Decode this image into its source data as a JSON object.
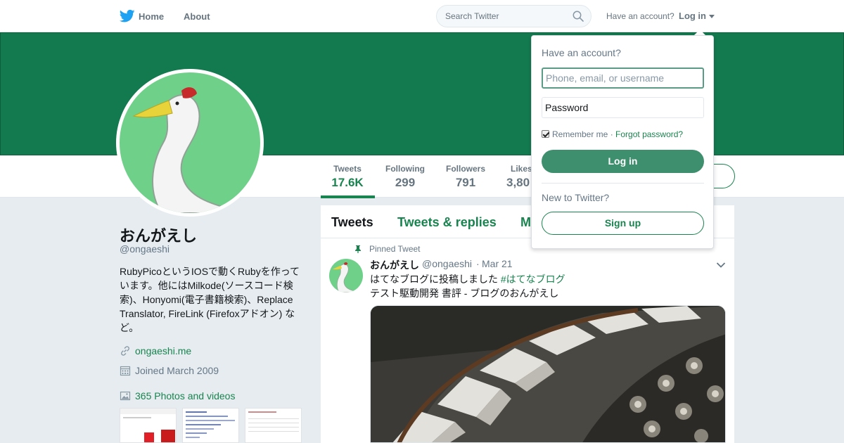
{
  "nav": {
    "logo_icon": "twitter-bird-icon",
    "home_label": "Home",
    "about_label": "About",
    "search_placeholder": "Search Twitter",
    "have_account": "Have an account?",
    "login_label": "Log in"
  },
  "colors": {
    "brand": "#19844f",
    "banner": "#137a4f",
    "background": "#e6ecf0"
  },
  "profile": {
    "name": "おんがえし",
    "handle": "@ongaeshi",
    "bio": "RubyPicoというIOSで動くRubyを作っています。他にはMilkode(ソースコード検索)、Honyomi(電子書籍検索)、Replace Translator, FireLink (Firefoxアドオン) など。",
    "website": "ongaeshi.me",
    "joined": "Joined March 2009",
    "photos_videos": "365 Photos and videos"
  },
  "stats": [
    {
      "label": "Tweets",
      "value": "17.6K"
    },
    {
      "label": "Following",
      "value": "299"
    },
    {
      "label": "Followers",
      "value": "791"
    },
    {
      "label": "Likes",
      "value": "3,80"
    }
  ],
  "tabs": [
    "Tweets",
    "Tweets & replies",
    "M"
  ],
  "tweet": {
    "pinned_label": "Pinned Tweet",
    "name": "おんがえし",
    "handle": "@ongaeshi",
    "separator": "·",
    "date": "Mar 21",
    "line1": "はてなブログに投稿しました",
    "hashtag": "#はてなブログ",
    "line2": "テスト駆動開発 書評 - ブログのおんがえし"
  },
  "login_dropdown": {
    "title": "Have an account?",
    "username_placeholder": "Phone, email, or username",
    "password_placeholder": "Password",
    "remember_me": "Remember me",
    "separator": "·",
    "forgot_password": "Forgot password?",
    "login_button": "Log in",
    "new_to_twitter": "New to Twitter?",
    "signup_button": "Sign up"
  }
}
